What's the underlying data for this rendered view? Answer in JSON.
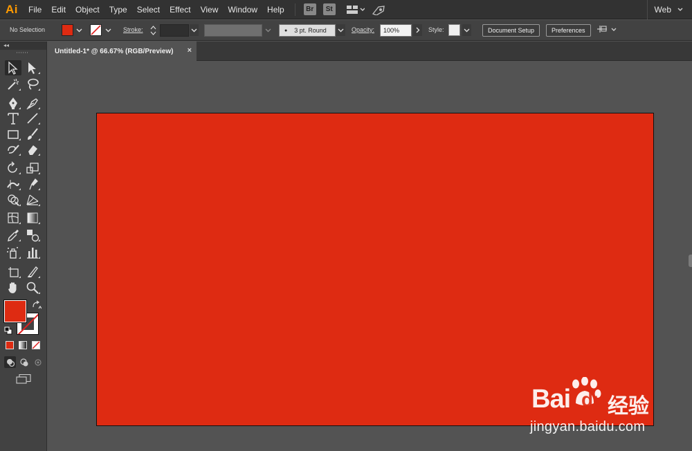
{
  "app": {
    "logo": "Ai",
    "accent": "#ff9a00"
  },
  "menu": {
    "items": [
      "File",
      "Edit",
      "Object",
      "Type",
      "Select",
      "Effect",
      "View",
      "Window",
      "Help"
    ],
    "bridge": "Br",
    "stock": "St",
    "workspace": "Web"
  },
  "control_bar": {
    "selection": "No Selection",
    "fill_color": "#de2b12",
    "stroke_label": "Stroke:",
    "brush": "3 pt. Round",
    "opacity_label": "Opacity:",
    "opacity_value": "100%",
    "style_label": "Style:",
    "document_setup": "Document Setup",
    "preferences": "Preferences"
  },
  "document_tab": {
    "title": "Untitled-1* @ 66.67% (RGB/Preview)",
    "close": "×"
  },
  "artboard": {
    "fill_color": "#de2b12"
  },
  "tools": {
    "fill_color": "#de2b12",
    "icons": [
      "selection-tool",
      "direct-selection-tool",
      "magic-wand-tool",
      "lasso-tool",
      "pen-tool",
      "curvature-tool",
      "type-tool",
      "line-segment-tool",
      "rectangle-tool",
      "paintbrush-tool",
      "shaper-tool",
      "eraser-tool",
      "rotate-tool",
      "scale-tool",
      "width-tool",
      "puppet-warp-tool",
      "shape-builder-tool",
      "perspective-grid-tool",
      "mesh-tool",
      "gradient-tool",
      "eyedropper-tool",
      "blend-tool",
      "symbol-sprayer-tool",
      "column-graph-tool",
      "artboard-tool",
      "slice-tool",
      "hand-tool",
      "zoom-tool"
    ]
  },
  "watermark": {
    "brand": "Bai",
    "brand2": "du",
    "chinese": "经验",
    "url": "jingyan.baidu.com"
  }
}
